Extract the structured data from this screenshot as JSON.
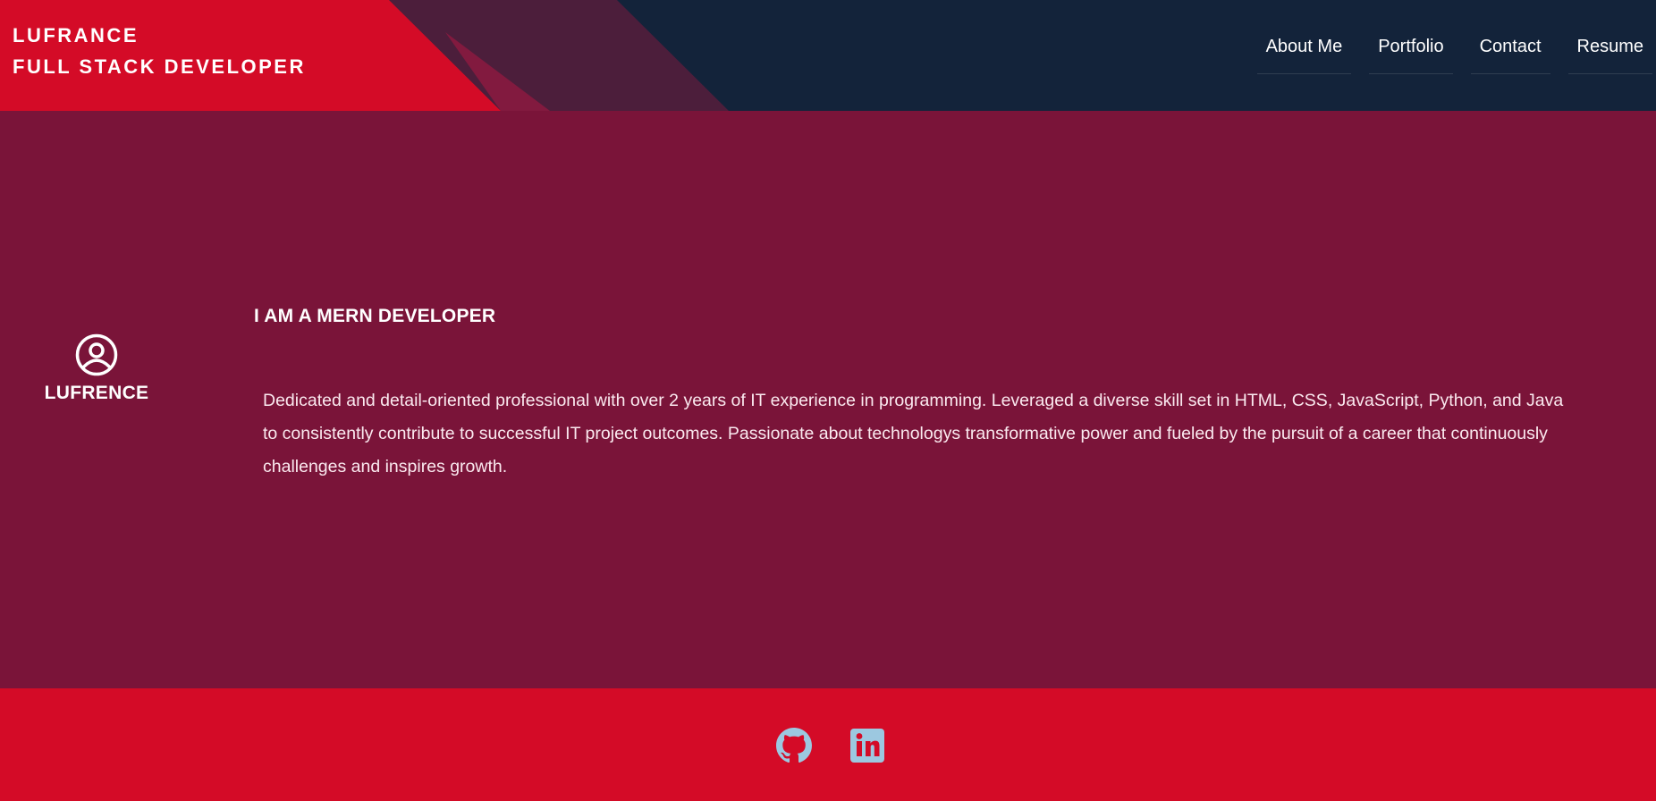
{
  "brand": {
    "name": "LUFRANCE",
    "role": "FULL STACK DEVELOPER"
  },
  "nav": {
    "items": [
      {
        "label": "About Me"
      },
      {
        "label": "Portfolio"
      },
      {
        "label": "Contact"
      },
      {
        "label": "Resume"
      }
    ]
  },
  "profile": {
    "icon": "user-circle-icon",
    "name": "LUFRENCE"
  },
  "about": {
    "headline": "I AM A MERN DEVELOPER",
    "bio": "Dedicated and detail-oriented professional with over 2 years of IT experience in programming. Leveraged a diverse skill set in HTML, CSS, JavaScript, Python, and Java to consistently contribute to successful IT project outcomes. Passionate about technologys transformative power and fueled by the pursuit of a career that continuously challenges and inspires growth."
  },
  "footer": {
    "links": [
      {
        "icon": "github-icon"
      },
      {
        "icon": "linkedin-icon"
      }
    ]
  },
  "colors": {
    "header_navy": "#13233a",
    "brand_red": "#d40b27",
    "main_maroon": "#7a1439",
    "social_icon": "#9cc8e0"
  }
}
